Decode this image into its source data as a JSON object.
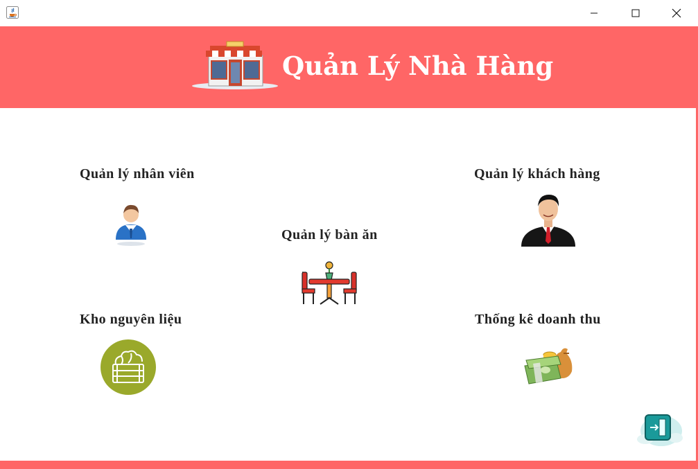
{
  "app": {
    "title": "Quản Lý Nhà Hàng"
  },
  "window_controls": {
    "minimize": "minimize",
    "maximize": "maximize",
    "close": "close"
  },
  "modules": [
    {
      "id": "staff",
      "label": "Quản lý nhân viên",
      "icon": "employee-icon"
    },
    {
      "id": "customers",
      "label": "Quản lý khách hàng",
      "icon": "businessman-icon"
    },
    {
      "id": "tables",
      "label": "Quản lý bàn ăn",
      "icon": "dining-table-icon"
    },
    {
      "id": "inventory",
      "label": "Kho nguyên liệu",
      "icon": "vegetable-crate-icon"
    },
    {
      "id": "revenue",
      "label": "Thống kê doanh thu",
      "icon": "money-bag-icon"
    }
  ],
  "exit": {
    "icon": "exit-door-icon"
  },
  "colors": {
    "header": "#ff6666",
    "title_text": "#ffffff",
    "label_text": "#222222",
    "crate_green": "#9aa92b",
    "exit_teal": "#1a9a9a"
  }
}
